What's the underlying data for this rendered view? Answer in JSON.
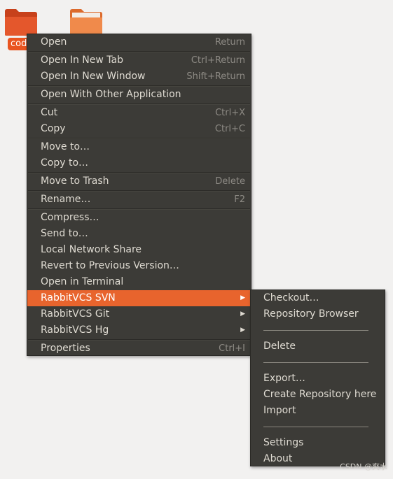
{
  "desktop": {
    "folder_label": "cod"
  },
  "main_menu": {
    "items": [
      {
        "label": "Open",
        "accel": "Return"
      },
      {
        "label": "Open In New Tab",
        "accel": "Ctrl+Return"
      },
      {
        "label": "Open In New Window",
        "accel": "Shift+Return"
      },
      {
        "label": "Open With Other Application",
        "accel": ""
      },
      {
        "label": "Cut",
        "accel": "Ctrl+X"
      },
      {
        "label": "Copy",
        "accel": "Ctrl+C"
      },
      {
        "label": "Move to…",
        "accel": ""
      },
      {
        "label": "Copy to…",
        "accel": ""
      },
      {
        "label": "Move to Trash",
        "accel": "Delete"
      },
      {
        "label": "Rename…",
        "accel": "F2"
      },
      {
        "label": "Compress…",
        "accel": ""
      },
      {
        "label": "Send to…",
        "accel": ""
      },
      {
        "label": "Local Network Share",
        "accel": ""
      },
      {
        "label": "Revert to Previous Version…",
        "accel": ""
      },
      {
        "label": "Open in Terminal",
        "accel": ""
      },
      {
        "label": "RabbitVCS SVN",
        "accel": ""
      },
      {
        "label": "RabbitVCS Git",
        "accel": ""
      },
      {
        "label": "RabbitVCS Hg",
        "accel": ""
      },
      {
        "label": "Properties",
        "accel": "Ctrl+I"
      }
    ],
    "active_item": "RabbitVCS SVN"
  },
  "sub_menu": {
    "items": [
      {
        "label": "Checkout…"
      },
      {
        "label": "Repository Browser"
      },
      {
        "label": "Delete"
      },
      {
        "label": "Export…"
      },
      {
        "label": "Create Repository here"
      },
      {
        "label": "Import"
      },
      {
        "label": "Settings"
      },
      {
        "label": "About"
      }
    ]
  },
  "watermark": "CSDN @爽水",
  "colors": {
    "menu_bg": "#3c3b37",
    "highlight": "#e8642d",
    "text": "#dfdbd2",
    "accel_text": "#8d8a84",
    "desktop_bg": "#f2f1f0"
  }
}
